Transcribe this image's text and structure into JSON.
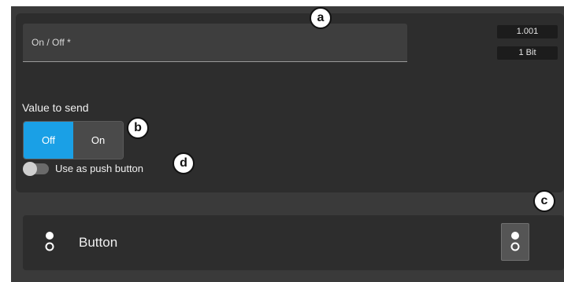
{
  "field": {
    "label": "On / Off *"
  },
  "tags": {
    "dpt": "1.001",
    "size": "1 Bit"
  },
  "value_to_send": {
    "label": "Value to send",
    "options": [
      "Off",
      "On"
    ],
    "selected": "Off"
  },
  "push_toggle": {
    "label": "Use as push button",
    "checked": false
  },
  "callouts": {
    "a": "a",
    "b": "b",
    "c": "c",
    "d": "d"
  },
  "widget": {
    "label": "Button",
    "icon": "dot-toggle-icon"
  },
  "colors": {
    "accent": "#1aa0e6",
    "panel": "#2d2d2d",
    "frame": "#3a3a3a"
  }
}
